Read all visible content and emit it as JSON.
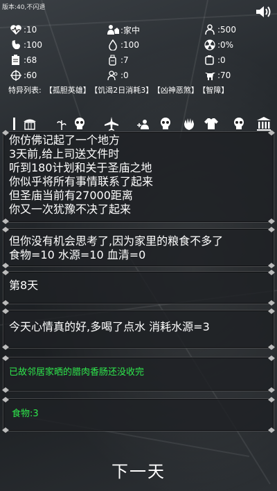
{
  "version": "版本:40,不闪退",
  "stats": [
    {
      "icon": "heart-pulse-icon",
      "value": ":10"
    },
    {
      "icon": "home-person-icon",
      "value": ":家中"
    },
    {
      "icon": "people-icon",
      "value": ":500"
    },
    {
      "icon": "stomach-icon",
      "value": ":100"
    },
    {
      "icon": "water-drop-icon",
      "value": ":100"
    },
    {
      "icon": "radiation-icon",
      "value": ":0%"
    },
    {
      "icon": "clipboard-icon",
      "value": ":68"
    },
    {
      "icon": "bottle-icon",
      "value": ":7"
    },
    {
      "icon": "ammo-icon",
      "value": ":0"
    },
    {
      "icon": "crosshair-icon",
      "value": ":60"
    },
    {
      "icon": "survivors-icon",
      "value": ":0"
    },
    {
      "icon": "cow-icon",
      "value": ":70"
    }
  ],
  "traits": {
    "label": "特异列表:",
    "items": [
      "【孤胆英雄】",
      "【饥渴2日消耗3】",
      "【凶神恶煞】",
      "【智障】"
    ]
  },
  "icon_row": [
    "bar-icon",
    "shop-icon",
    "plant-icon",
    "skull-icon",
    "plane-icon",
    "add-person-icon",
    "skull-icon",
    "hand-icon",
    "shirt-icon",
    "skull-icon",
    "temple-icon"
  ],
  "panels": {
    "story": [
      "你仿佛记起了一个地方",
      "3天前,给上司送文件时",
      "听到180计划和关于圣庙之地",
      "你似乎将所有事情联系了起来",
      "但圣庙当前有27000距离",
      "你又一次犹豫不决了起来"
    ],
    "supplies": [
      "但你没有机会思考了,因为家里的粮食不多了",
      "食物=10  水源=10  血清=0"
    ],
    "day": "第8天",
    "mood": "今天心情真的好,多喝了点水 消耗水源=3",
    "event": "已故邻居家晒的腊肉香肠还没收完",
    "food": "食物:3"
  },
  "next_button": "下一天",
  "colors": {
    "accent_green": "#2ee84c",
    "panel_bg": "#1e2124"
  }
}
